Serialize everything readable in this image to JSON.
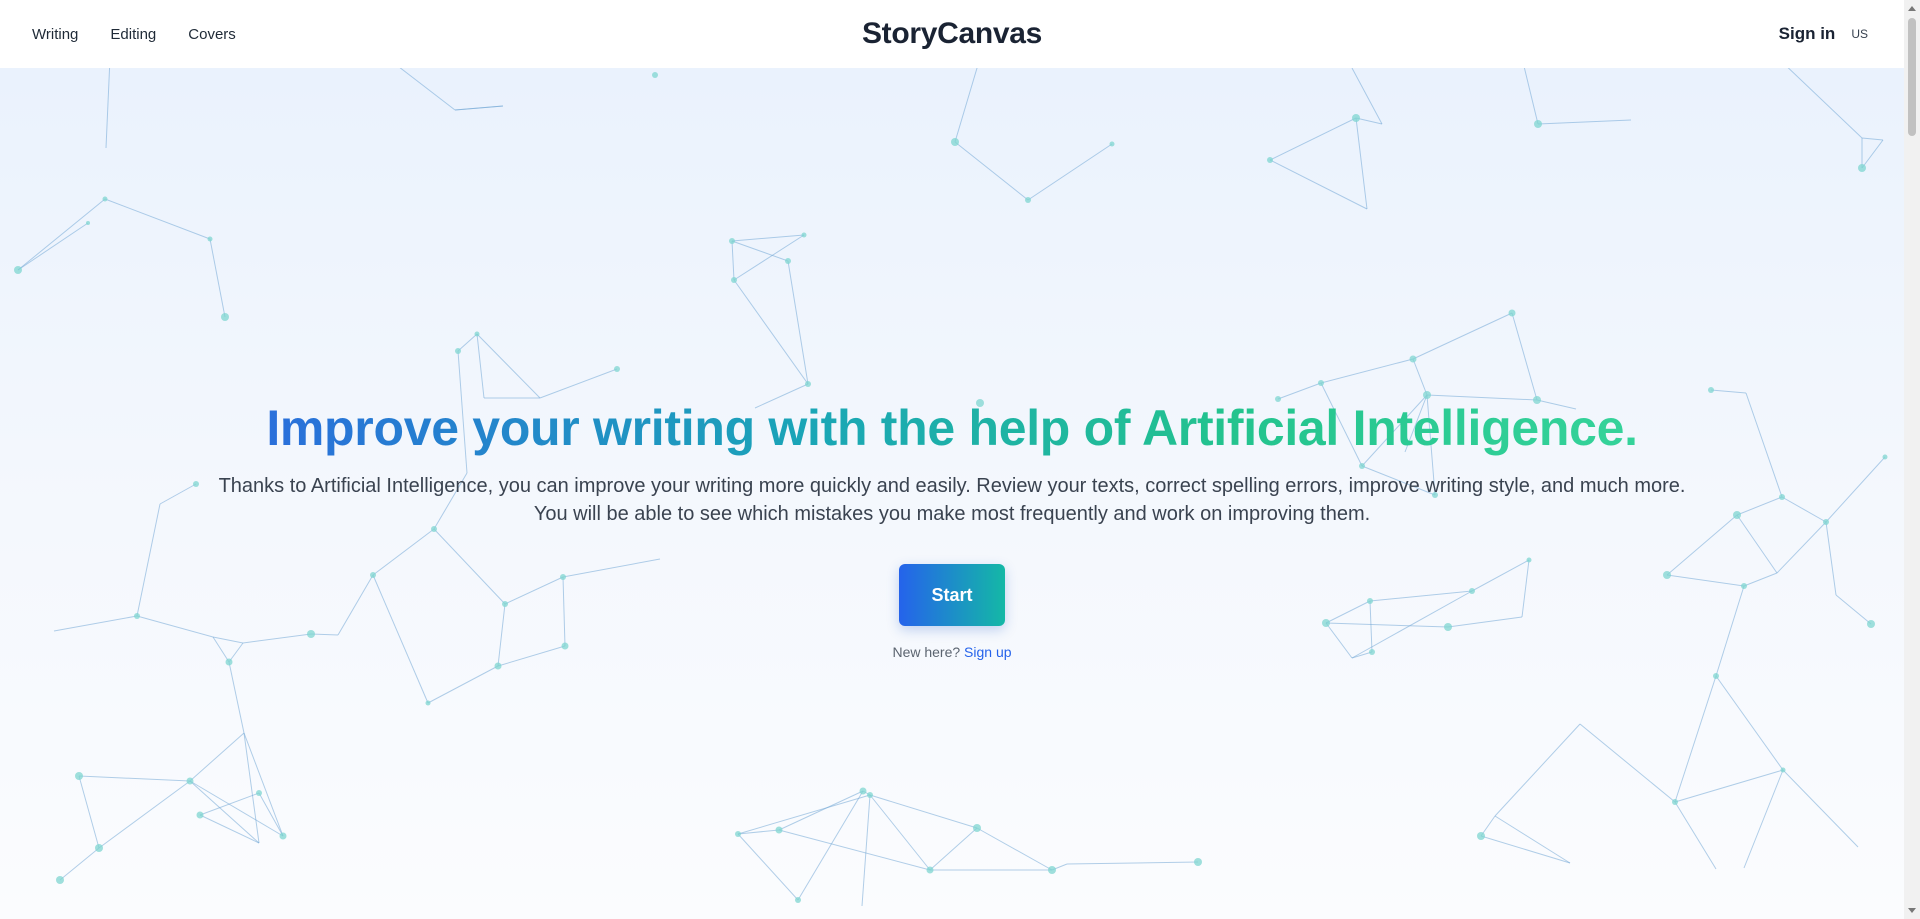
{
  "header": {
    "nav": [
      "Writing",
      "Editing",
      "Covers"
    ],
    "brand": "StoryCanvas",
    "signin": "Sign in",
    "locale": "US"
  },
  "hero": {
    "headline": "Improve your writing with the help of Artificial Intelligence.",
    "subtitle": "Thanks to Artificial Intelligence, you can improve your writing more quickly and easily. Review your texts, correct spelling errors, improve writing style, and much more. You will be able to see which mistakes you make most frequently and work on improving them.",
    "cta": "Start",
    "signup_prompt": "New here?",
    "signup_link": "Sign up"
  },
  "colors": {
    "accent_blue": "#2563eb",
    "accent_teal": "#14b8a6",
    "headline_gradient_start": "#2a6fdb",
    "headline_gradient_end": "#35d39a"
  }
}
